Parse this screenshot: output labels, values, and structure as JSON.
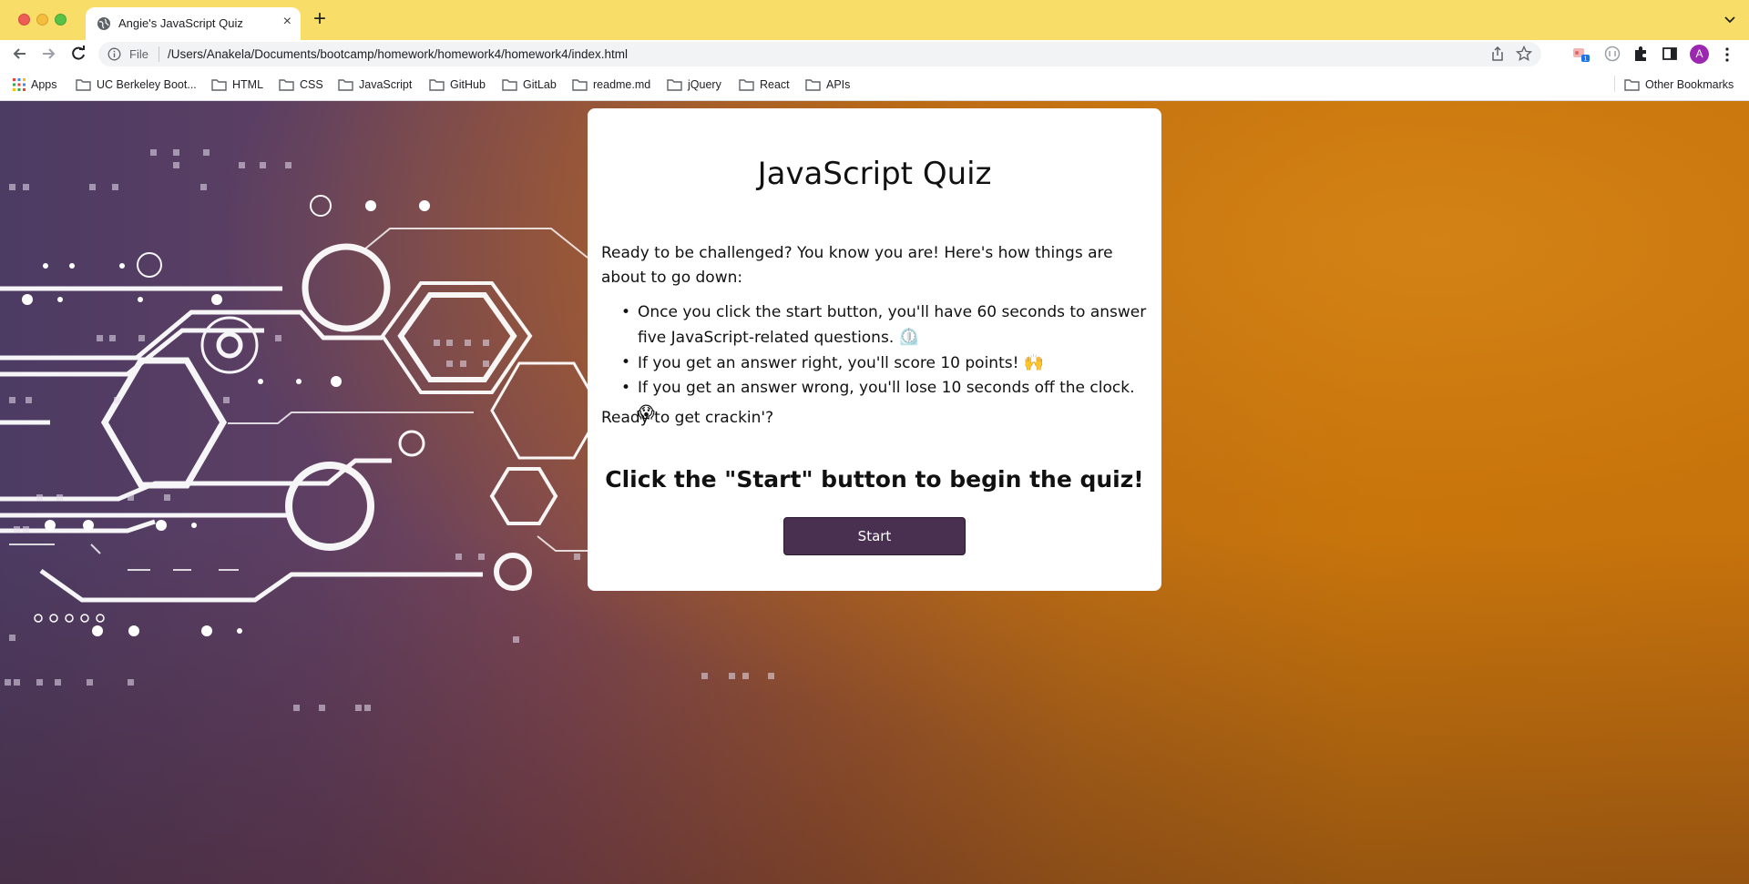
{
  "browser": {
    "tab_title": "Angie's JavaScript Quiz",
    "tab_close": "×",
    "new_tab": "+",
    "omnibox_scheme": "File",
    "url": "/Users/Anakela/Documents/bootcamp/homework/homework4/homework4/index.html",
    "avatar_initial": "A",
    "extension_badge": "1"
  },
  "bookmarks": {
    "items": [
      "Apps",
      "UC Berkeley Boot...",
      "HTML",
      "CSS",
      "JavaScript",
      "GitHub",
      "GitLab",
      "readme.md",
      "jQuery",
      "React",
      "APIs"
    ],
    "other": "Other Bookmarks"
  },
  "quiz": {
    "title": "JavaScript Quiz",
    "intro": "Ready to be challenged? You know you are! Here's how things are about to go down:",
    "rules": [
      {
        "text": "Once you click the start button, you'll have 60 seconds to answer five JavaScript-related questions.",
        "emoji": "⏲️"
      },
      {
        "text": "If you get an answer right, you'll score 10 points!",
        "emoji": "🙌"
      },
      {
        "text": "If you get an answer wrong, you'll lose 10 seconds off the clock.",
        "emoji": "😱"
      }
    ],
    "ready": "Ready to get crackin'?",
    "prompt": "Click the \"Start\" button to begin the quiz!",
    "start_label": "Start"
  },
  "colors": {
    "tabbar": "#f9dd69",
    "button": "#4a3050",
    "bg_left": "#4c3b63",
    "bg_right": "#c8760d"
  }
}
